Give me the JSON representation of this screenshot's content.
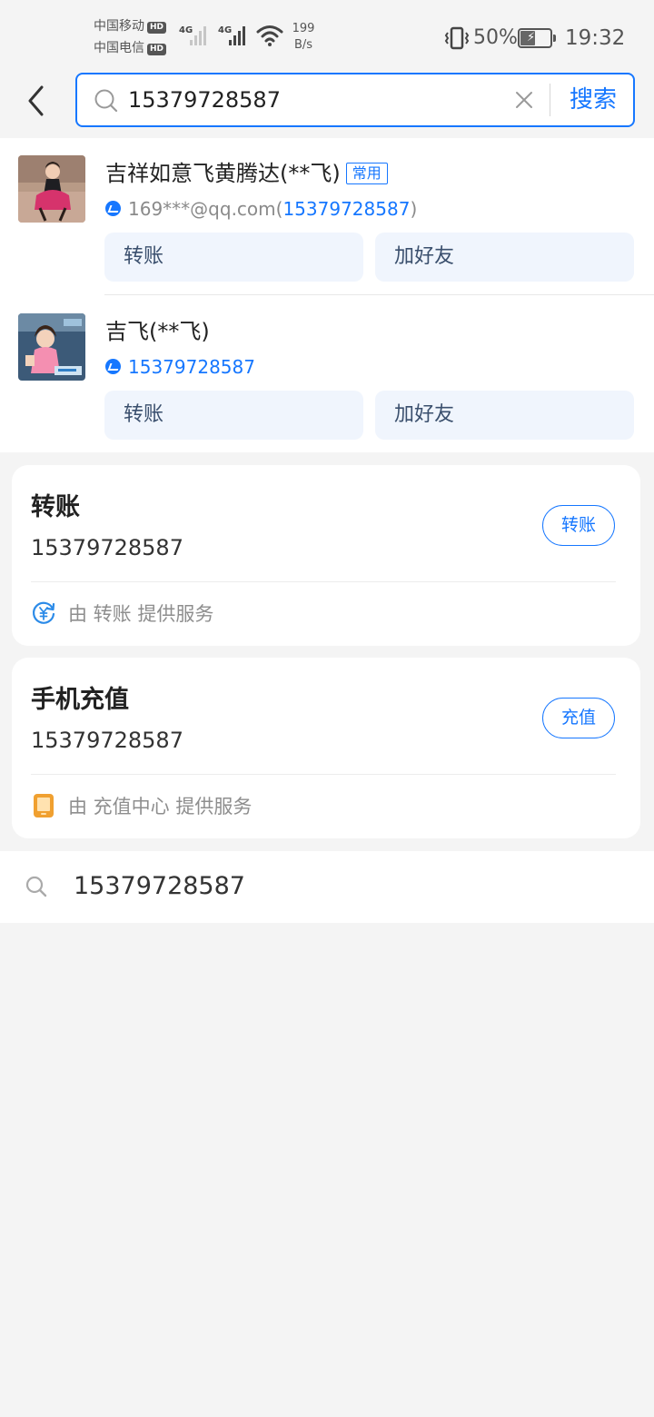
{
  "status_bar": {
    "carrier_1": "中国移动",
    "carrier_2": "中国电信",
    "hd_label": "HD",
    "network_type": "4G",
    "net_speed_value": "199",
    "net_speed_unit": "B/s",
    "battery_percent": "50%",
    "battery_level": 0.5,
    "time": "19:32"
  },
  "search": {
    "value": "15379728587",
    "submit_label": "搜索"
  },
  "contacts": [
    {
      "name": "吉祥如意飞黄腾达(**飞)",
      "badge": "常用",
      "account_prefix": "169***@qq.com(",
      "account_phone": "15379728587",
      "account_suffix": ")",
      "action_transfer": "转账",
      "action_add_friend": "加好友"
    },
    {
      "name": "吉飞(**飞)",
      "account_phone": "15379728587",
      "action_transfer": "转账",
      "action_add_friend": "加好友"
    }
  ],
  "services": [
    {
      "title": "转账",
      "number": "15379728587",
      "button": "转账",
      "provider_text": "由 转账 提供服务"
    },
    {
      "title": "手机充值",
      "number": "15379728587",
      "button": "充值",
      "provider_text": "由 充值中心 提供服务"
    }
  ],
  "suggestion": {
    "text": "15379728587"
  },
  "colors": {
    "accent": "#1677ff",
    "background": "#f4f4f4",
    "action_bg": "#f0f5fd",
    "recharge_icon": "#f0a030"
  },
  "icons": {
    "back": "chevron-left-icon",
    "search": "search-icon",
    "clear": "close-icon",
    "alipay": "alipay-icon",
    "transfer_service": "yuan-transfer-icon",
    "recharge_service": "phone-icon"
  }
}
